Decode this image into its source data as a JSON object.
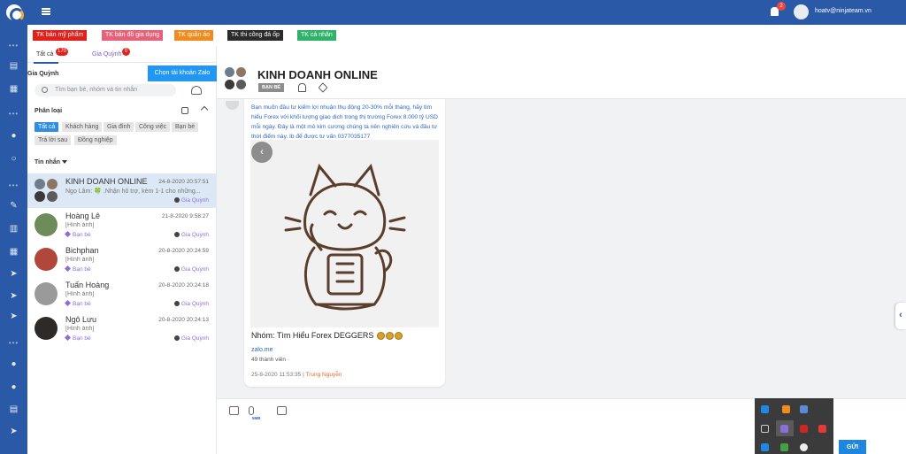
{
  "header": {
    "notification_count": "2",
    "user_email": "hoatv@ninjateam.vn"
  },
  "category_tags": [
    {
      "label": "TK bán mỹ phẩm",
      "color": "#e1221c"
    },
    {
      "label": "TK bán đồ gia dụng",
      "color": "#e8617a"
    },
    {
      "label": "TK quần áo",
      "color": "#f08c1e"
    },
    {
      "label": "TK thi công đá ốp",
      "color": "#2b2b2b"
    },
    {
      "label": "TK cá nhân",
      "color": "#2fb36b"
    }
  ],
  "tabs": [
    {
      "label": "Tất cả",
      "count": "170"
    },
    {
      "label": "Gia Quỳnh",
      "count": "0"
    }
  ],
  "account": {
    "name": "Gia Quỳnh",
    "choose_button": "Chọn tài khoản Zalo"
  },
  "search": {
    "placeholder": "Tìm bạn bè, nhóm và tin nhắn"
  },
  "classify": {
    "title": "Phân loại",
    "chips": [
      "Tất cả",
      "Khách hàng",
      "Gia đình",
      "Công việc",
      "Bạn bè",
      "Trả lời sau",
      "Đồng nghiệp"
    ]
  },
  "messages_title": "Tin nhắn",
  "conversations": [
    {
      "name": "KINH DOANH ONLINE",
      "time": "24-8-2020 20:57:51",
      "preview": "Ngọ Lâm: 🍀 .Nhận hỗ trợ, kèm 1-1 cho những...",
      "label": "",
      "owner": "Gia Quỳnh"
    },
    {
      "name": "Hoàng Lê",
      "time": "21-8-2020 9:58:27",
      "preview": "[Hình ảnh]",
      "label": "Bạn bè",
      "owner": "Gia Quỳnh"
    },
    {
      "name": "Bichphan",
      "time": "20-8-2020 20:24:59",
      "preview": "[Hình ảnh]",
      "label": "Bạn bè",
      "owner": "Gia Quỳnh"
    },
    {
      "name": "Tuấn Hoàng",
      "time": "20-8-2020 20:24:18",
      "preview": "[Hình ảnh]",
      "label": "Bạn bè",
      "owner": "Gia Quỳnh"
    },
    {
      "name": "Ngô Lưu",
      "time": "20-8-2020 20:24:13",
      "preview": "[Hình ảnh]",
      "label": "Bạn bè",
      "owner": "Gia Quỳnh"
    }
  ],
  "chat": {
    "title": "KINH DOANH ONLINE",
    "badge": "BẠN BÈ",
    "message_text": "Bạn muốn đầu tư kiếm lợi nhuận thụ động 20-30% mỗi tháng, hãy tìm hiểu Forex với khối lượng giao dịch trong thị trường Forex 8.000 tỷ USD mỗi ngày. Đây là một mỏ kim cương chúng ta nên nghiên cứu và đầu tư thời điểm này. Ib để được tư vấn 0377035177",
    "group_name": "Nhóm: Tìm Hiểu Forex DEGGERS",
    "link": "zalo.me",
    "members": "49 thành viên ·",
    "time": "25-8-2020 11:53:35 |",
    "sender": "Trung Nguyễn"
  },
  "composer": {
    "size_note": "5MB",
    "send_label": "GỬI"
  }
}
